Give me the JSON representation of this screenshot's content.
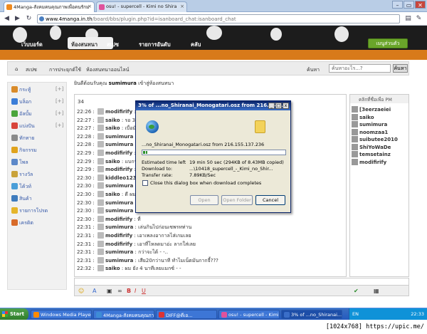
{
  "browser": {
    "tabs": [
      {
        "label": "4Manga-สังคมคนคุณภาพเพื่อคนรักม",
        "active": true
      },
      {
        "label": "osu! - supercell - Kimi no Shira",
        "active": false
      }
    ],
    "url": {
      "host": "www.4manga.in.th",
      "path": "/board/bbs/plugin.php?id=isanboard_chat:isanboard_chat"
    },
    "window_buttons": [
      "–",
      "▭",
      "✕"
    ]
  },
  "site": {
    "nav": [
      "เว็บบอร์ด",
      "ห้องสนทนา",
      "สเปซ",
      "รายการอันดับ",
      "คลับ"
    ],
    "login_button": "เมนูส่วนตัว",
    "breadcrumb": [
      "สเปซ",
      "การประยุกต์ใช้",
      "ห้องสนทนาออนไลน์"
    ],
    "search_label": "ค้นหา",
    "search_placeholder": "ค้นหาอะไร...?",
    "search_button": "ค้นหา"
  },
  "sidebar": {
    "items": [
      {
        "label": "กระทู้",
        "plus": "[+]",
        "color": "#d98b2a"
      },
      {
        "label": "บล็อก",
        "plus": "[+]",
        "color": "#3b7dd8"
      },
      {
        "label": "อัลบั้ม",
        "plus": "[+]",
        "color": "#4aa53b"
      },
      {
        "label": "แบ่งปัน",
        "plus": "[+]",
        "color": "#d8453b"
      },
      {
        "label": "ทักทาย",
        "plus": "",
        "color": "#8a8a8a"
      },
      {
        "label": "กิจกรรม",
        "plus": "",
        "color": "#e0a31d"
      },
      {
        "label": "โพล",
        "plus": "",
        "color": "#5c88c9"
      },
      {
        "label": "รางวัล",
        "plus": "",
        "color": "#c9a23a"
      },
      {
        "label": "โค้วท์",
        "plus": "",
        "color": "#4a9ed8"
      },
      {
        "label": "สินค้า",
        "plus": "",
        "color": "#3e7bbd"
      },
      {
        "label": "รายการโปรด",
        "plus": "",
        "color": "#e5b52a"
      },
      {
        "label": "เครดิต",
        "plus": "",
        "color": "#d86b2a"
      }
    ]
  },
  "chat": {
    "welcome_prefix": "ยินดีต้อนรับคุณ",
    "welcome_user": "sumimura",
    "welcome_suffix": "เข้าสู่ห้องสนทนา",
    "count": "34",
    "messages": [
      {
        "time": "22:26",
        "name": "modifirify",
        "text": ": ซื้อ"
      },
      {
        "time": "22:27",
        "name": "saiko",
        "text": ": รอ 3 นา"
      },
      {
        "time": "22:27",
        "name": "saiko",
        "text": ": เบื่อมัน"
      },
      {
        "time": "22:28",
        "name": "sumimura",
        "text": ": ป"
      },
      {
        "time": "22:28",
        "name": "sumimura",
        "text": ": เ"
      },
      {
        "time": "22:29",
        "name": "modifirify",
        "text": ": อ"
      },
      {
        "time": "22:29",
        "name": "saiko",
        "text": ": แบกร์"
      },
      {
        "time": "22:29",
        "name": "modifirify",
        "text": ": ผ"
      },
      {
        "time": "22:30",
        "name": "kiddleo123",
        "text": ":"
      },
      {
        "time": "22:30",
        "name": "sumimura",
        "text": ":"
      },
      {
        "time": "22:30",
        "name": "saiko",
        "text": ": ดี ผมก"
      },
      {
        "time": "22:30",
        "name": "sumimura",
        "text": ": จ"
      },
      {
        "time": "22:30",
        "name": "sumimura",
        "text": ": ทำไมมีแต่คนขอเพลงนี้"
      },
      {
        "time": "22:30",
        "name": "modifirify",
        "text": ": ที่"
      },
      {
        "time": "22:31",
        "name": "sumimura",
        "text": ": เล่นกินไปก่อนเซพรทท่าน"
      },
      {
        "time": "22:31",
        "name": "modifirify",
        "text": ": เอาเพลงอากาลไส่เกมเลย"
      },
      {
        "time": "22:31",
        "name": "modifirify",
        "text": ": เอาที่โหลดมาอ่ะ ลากใส่เลย"
      },
      {
        "time": "22:31",
        "name": "sumimura",
        "text": ": กว่าจะได้ - -.."
      },
      {
        "time": "22:31",
        "name": "sumimura",
        "text": ": เสีย20กว่านาที ทำไมเน็ตมันกากจี้???"
      },
      {
        "time": "22:32",
        "name": "saiko",
        "text": ": ผม ยัง 4 นาทีเลยแมกซ์ - -"
      }
    ]
  },
  "userlist": {
    "header": "คลิกที่ชื่อเพื่อ PM",
    "users": [
      "[3eerzaeiei",
      "saiko",
      "sumimura",
      "noomzaa1",
      "suibutee2010",
      "ShiYoWaDe",
      "temsetainz",
      "modifirify"
    ]
  },
  "download_dialog": {
    "title": "3% of ...no_Shiranai_Monogatari.osz from 216.155....",
    "filename_line": "...no_Shiranai_Monogatari.osz from 216.155.137.236",
    "progress_percent": 3,
    "rows": [
      {
        "label": "Estimated time left",
        "value": "19 min 50 sec (294KB of 8.43MB copied)"
      },
      {
        "label": "Download to:",
        "value": "...\\10418_supercell_-_Kimi_no_Shir..."
      },
      {
        "label": "Transfer rate:",
        "value": "7.89KB/Sec"
      }
    ],
    "checkbox_label": "Close this dialog box when download completes",
    "buttons": {
      "open": "Open",
      "open_folder": "Open Folder",
      "cancel": "Cancel"
    },
    "title_buttons": [
      "_",
      "□",
      "x"
    ]
  },
  "taskbar": {
    "start": "Start",
    "items": [
      {
        "label": "Windows Media Player",
        "color": "#ff8a00"
      },
      {
        "label": "4Manga-สังคมคนคุณภา...",
        "color": "#3e8cd6"
      },
      {
        "label": "DIFF@ดีเอ...",
        "color": "#d33"
      },
      {
        "label": "osu! - supercell - Kimi...",
        "color": "#e0529c"
      },
      {
        "label": "3% of ...no_Shiranai...",
        "color": "#3a6ec8"
      }
    ],
    "tray_lang": "EN",
    "clock": "22:33"
  },
  "watermark": "[1024x768] https://upic.me/"
}
